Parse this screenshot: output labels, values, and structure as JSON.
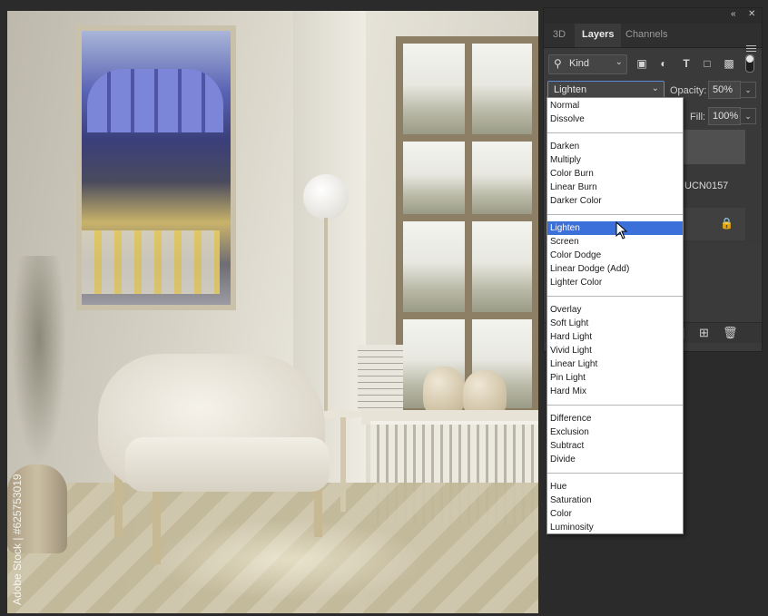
{
  "canvas": {
    "watermark": "Adobe Stock | #625753019"
  },
  "panel": {
    "collapse_icon": "double-chevron-icon",
    "close_icon": "close-icon",
    "tabs": [
      {
        "label": "3D"
      },
      {
        "label": "Layers"
      },
      {
        "label": "Channels"
      }
    ],
    "active_tab": "Layers",
    "filter": {
      "label": "Kind",
      "icons": [
        "search-icon",
        "image-filter-icon",
        "adjustment-filter-icon",
        "type-filter-icon",
        "shape-filter-icon",
        "smart-object-filter-icon"
      ]
    },
    "blend_mode": "Lighten",
    "opacity_label": "Opacity:",
    "opacity_value": "50%",
    "fill_label": "Fill:",
    "fill_value": "100%",
    "layer_name": "UCN0157"
  },
  "blend_menu": {
    "highlighted": "Lighten",
    "highlight_color": "#3b6fd9",
    "groups": [
      [
        "Normal",
        "Dissolve"
      ],
      [
        "Darken",
        "Multiply",
        "Color Burn",
        "Linear Burn",
        "Darker Color"
      ],
      [
        "Lighten",
        "Screen",
        "Color Dodge",
        "Linear Dodge (Add)",
        "Lighter Color"
      ],
      [
        "Overlay",
        "Soft Light",
        "Hard Light",
        "Vivid Light",
        "Linear Light",
        "Pin Light",
        "Hard Mix"
      ],
      [
        "Difference",
        "Exclusion",
        "Subtract",
        "Divide"
      ],
      [
        "Hue",
        "Saturation",
        "Color",
        "Luminosity"
      ]
    ]
  }
}
